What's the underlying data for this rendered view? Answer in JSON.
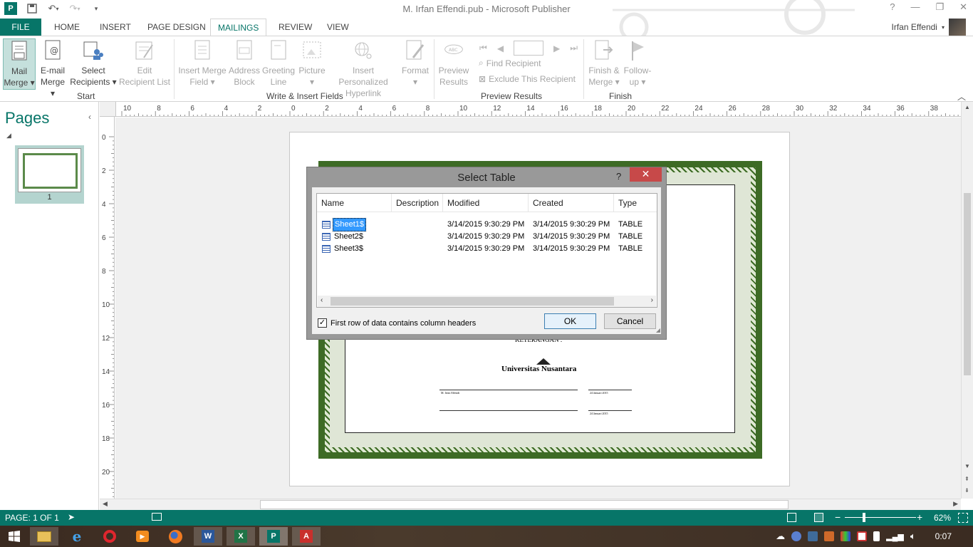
{
  "window": {
    "title": "M. Irfan Effendi.pub - Microsoft Publisher",
    "help": "?",
    "minimize": "—",
    "restore": "❐",
    "close": "✕"
  },
  "tabs": {
    "file": "FILE",
    "items": [
      "HOME",
      "INSERT",
      "PAGE DESIGN",
      "MAILINGS",
      "REVIEW",
      "VIEW"
    ],
    "active": "MAILINGS"
  },
  "user": {
    "name": "Irfan Effendi"
  },
  "ribbon": {
    "start": {
      "label": "Start",
      "mail_merge": [
        "Mail",
        "Merge ▾"
      ],
      "email_merge": [
        "E-mail",
        "Merge ▾"
      ],
      "select_recipients": [
        "Select",
        "Recipients ▾"
      ],
      "edit_recipient_list": [
        "Edit",
        "Recipient List"
      ]
    },
    "write": {
      "label": "Write & Insert Fields",
      "insert_merge_field": [
        "Insert Merge",
        "Field ▾"
      ],
      "address_block": [
        "Address",
        "Block"
      ],
      "greeting_line": [
        "Greeting",
        "Line"
      ],
      "picture": [
        "Picture",
        "▾"
      ],
      "hyperlink": [
        "Insert Personalized",
        "Hyperlink"
      ],
      "format": [
        "Format",
        "▾"
      ]
    },
    "preview": {
      "label": "Preview Results",
      "preview_results": [
        "Preview",
        "Results"
      ],
      "find_recipient": "Find Recipient",
      "exclude_recipient": "Exclude This Recipient"
    },
    "finish": {
      "label": "Finish",
      "finish_merge": [
        "Finish &",
        "Merge ▾"
      ],
      "follow_up": [
        "Follow-",
        "up ▾"
      ]
    }
  },
  "pages_pane": {
    "title": "Pages",
    "page_number": "1"
  },
  "ruler": {
    "h": [
      "10",
      "8",
      "6",
      "4",
      "2",
      "0",
      "2",
      "4",
      "6",
      "8",
      "10",
      "12",
      "14",
      "16",
      "18",
      "20",
      "22",
      "24",
      "26",
      "28",
      "30",
      "32",
      "34",
      "36",
      "38"
    ],
    "v": [
      "0",
      "2",
      "4",
      "6",
      "8",
      "10",
      "12",
      "14",
      "16",
      "18",
      "20"
    ]
  },
  "certificate": {
    "keterangan": "KETERANGAN :",
    "university": "Universitas Nusantara",
    "sign_name": "M. Irfan Effendi",
    "date": "24 Januari 2015"
  },
  "dialog": {
    "title": "Select Table",
    "help": "?",
    "columns": [
      "Name",
      "Description",
      "Modified",
      "Created",
      "Type"
    ],
    "rows": [
      {
        "name": "Sheet1$",
        "description": "",
        "modified": "3/14/2015 9:30:29 PM",
        "created": "3/14/2015 9:30:29 PM",
        "type": "TABLE"
      },
      {
        "name": "Sheet2$",
        "description": "",
        "modified": "3/14/2015 9:30:29 PM",
        "created": "3/14/2015 9:30:29 PM",
        "type": "TABLE"
      },
      {
        "name": "Sheet3$",
        "description": "",
        "modified": "3/14/2015 9:30:29 PM",
        "created": "3/14/2015 9:30:29 PM",
        "type": "TABLE"
      }
    ],
    "selected_row": 0,
    "checkbox_label": "First row of data contains column headers",
    "checkbox_checked": true,
    "ok": "OK",
    "cancel": "Cancel"
  },
  "status": {
    "page": "PAGE: 1 OF 1",
    "zoom": "62%"
  },
  "taskbar": {
    "clock": "0:07",
    "apps": [
      "file-explorer",
      "internet-explorer",
      "opera",
      "media-player",
      "firefox",
      "word",
      "excel",
      "publisher",
      "acrobat"
    ]
  }
}
